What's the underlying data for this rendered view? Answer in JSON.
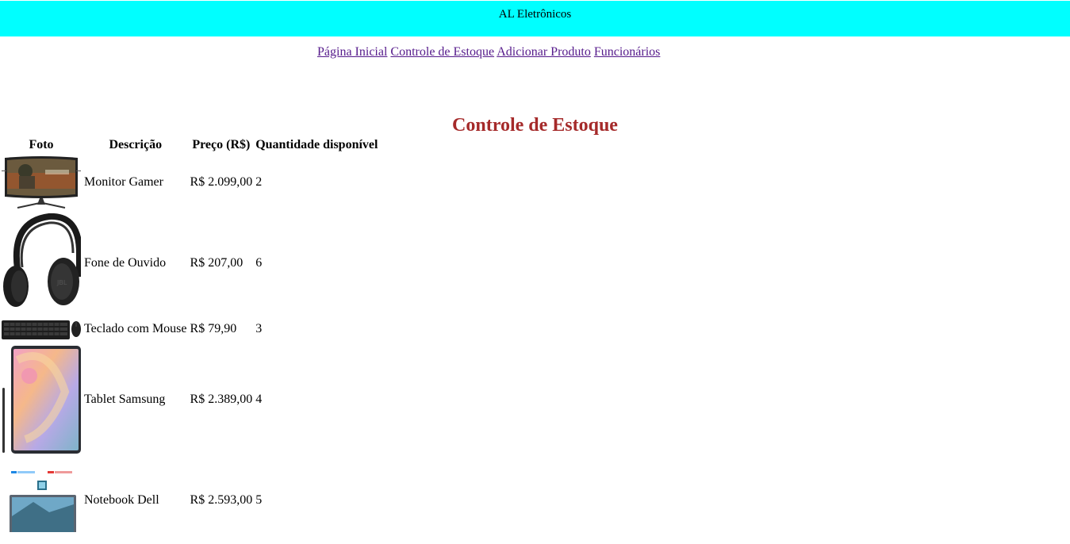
{
  "header": {
    "title": "AL Eletrônicos"
  },
  "nav": {
    "home": "Página Inicial",
    "stock": "Controle de Estoque",
    "add": "Adicionar Produto",
    "employees": "Funcionários"
  },
  "page_title": "Controle de Estoque",
  "table": {
    "headers": [
      "Foto",
      "Descrição",
      "Preço (R$)",
      "Quantidade disponível"
    ],
    "rows": [
      {
        "description": "Monitor Gamer",
        "price": "R$ 2.099,00",
        "qty": "2",
        "image": "monitor-image"
      },
      {
        "description": "Fone de Ouvido",
        "price": "R$ 207,00",
        "qty": "6",
        "image": "headphones-image"
      },
      {
        "description": "Teclado com Mouse",
        "price": "R$ 79,90",
        "qty": "3",
        "image": "keyboard-mouse-image"
      },
      {
        "description": "Tablet Samsung",
        "price": "R$ 2.389,00",
        "qty": "4",
        "image": "tablet-image"
      },
      {
        "description": "Notebook Dell",
        "price": "R$ 2.593,00",
        "qty": "5",
        "image": "notebook-image"
      }
    ]
  },
  "colors": {
    "header_bg": "#00ffff",
    "title_color": "#a52a2a",
    "link_color": "#551a8b"
  }
}
